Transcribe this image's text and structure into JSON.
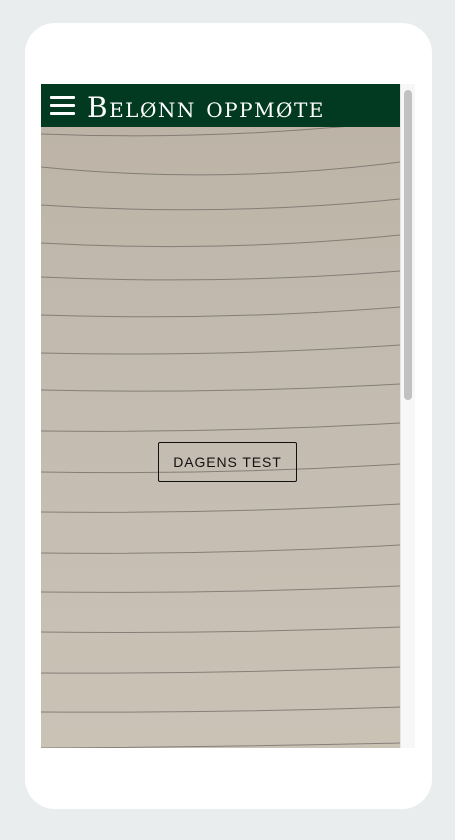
{
  "header": {
    "title": "Belønn oppmøte",
    "menu_icon": "hamburger-menu-icon",
    "background_color": "#013a20"
  },
  "main": {
    "button_label": "DAGENS TEST",
    "background_image": "lined notebook paper"
  }
}
